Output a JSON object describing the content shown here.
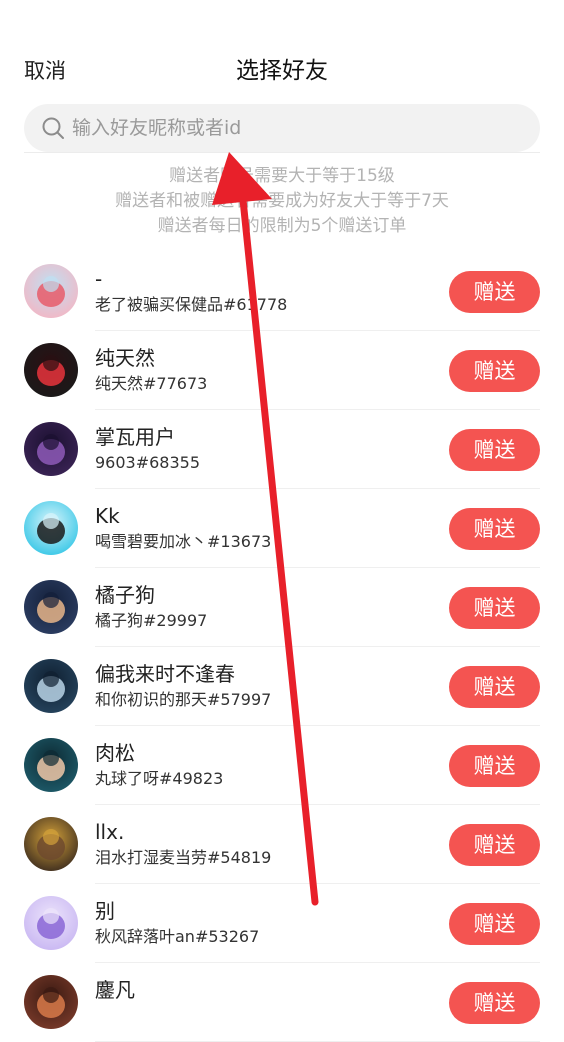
{
  "header": {
    "cancel_label": "取消",
    "title": "选择好友"
  },
  "search": {
    "placeholder": "输入好友昵称或者id",
    "value": ""
  },
  "notice": {
    "lines": [
      "赠送者账号需要大于等于15级",
      "赠送者和被赠送者需要成为好友大于等于7天",
      "赠送者每日的限制为5个赠送订单"
    ]
  },
  "friends": [
    {
      "name": "-",
      "sub": "老了被骗买保健品#61778",
      "button": "赠送",
      "avatar_colors": [
        "#f4b6c4",
        "#e85c6a",
        "#bfe0f2"
      ]
    },
    {
      "name": "纯天然",
      "sub": "纯天然#77673",
      "button": "赠送",
      "avatar_colors": [
        "#1a1a1a",
        "#e8343c",
        "#2a0f12"
      ]
    },
    {
      "name": "掌瓦用户",
      "sub": "9603#68355",
      "button": "赠送",
      "avatar_colors": [
        "#3b2456",
        "#8e5ab8",
        "#1b1030"
      ]
    },
    {
      "name": "Kk",
      "sub": "喝雪碧要加冰丶#13673",
      "button": "赠送",
      "avatar_colors": [
        "#34c6e6",
        "#1a1a1a",
        "#d8f4fb"
      ]
    },
    {
      "name": "橘子狗",
      "sub": "橘子狗#29997",
      "button": "赠送",
      "avatar_colors": [
        "#2c3e63",
        "#e8b58a",
        "#14203a"
      ]
    },
    {
      "name": "偏我来时不逢春",
      "sub": "和你初识的那天#57997",
      "button": "赠送",
      "avatar_colors": [
        "#26445e",
        "#b8d4e6",
        "#0f1f30"
      ]
    },
    {
      "name": "肉松",
      "sub": "丸球了呀#49823",
      "button": "赠送",
      "avatar_colors": [
        "#1e5b6a",
        "#f0c8a8",
        "#0d2a33"
      ]
    },
    {
      "name": "llx.",
      "sub": "泪水打湿麦当劳#54819",
      "button": "赠送",
      "avatar_colors": [
        "#3a2a1e",
        "#6e4a2e",
        "#d4a23a"
      ]
    },
    {
      "name": "别",
      "sub": "秋风辞落叶an#53267",
      "button": "赠送",
      "avatar_colors": [
        "#c8b6f2",
        "#8a66d6",
        "#ece4fb"
      ]
    },
    {
      "name": "鏖凡",
      "sub": "",
      "button": "赠送",
      "avatar_colors": [
        "#7a3a2a",
        "#d87a4a",
        "#3a1a12"
      ]
    }
  ],
  "colors": {
    "accent": "#f45451",
    "notice_text": "#b3b3b3",
    "search_bg": "#f2f2f2",
    "annotation_arrow": "#e8202a"
  }
}
